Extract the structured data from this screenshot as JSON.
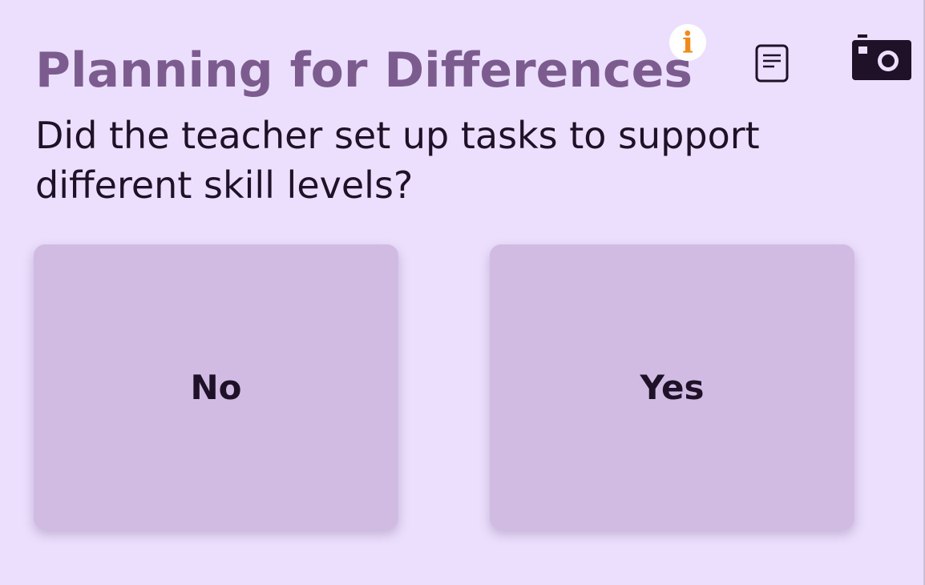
{
  "page": {
    "title": "Planning for Differences",
    "question": "Did the teacher set up tasks to support different skill levels?"
  },
  "toolbar": {
    "info_glyph": "i",
    "info_icon": "info-icon",
    "notes_icon": "notes-icon",
    "camera_icon": "camera-icon"
  },
  "answers": [
    {
      "label": "No"
    },
    {
      "label": "Yes"
    }
  ],
  "colors": {
    "background": "#ecdffd",
    "title": "#7c5c8e",
    "text": "#1f1128",
    "card": "#d1bbe3",
    "info_accent": "#ef8a1b"
  }
}
